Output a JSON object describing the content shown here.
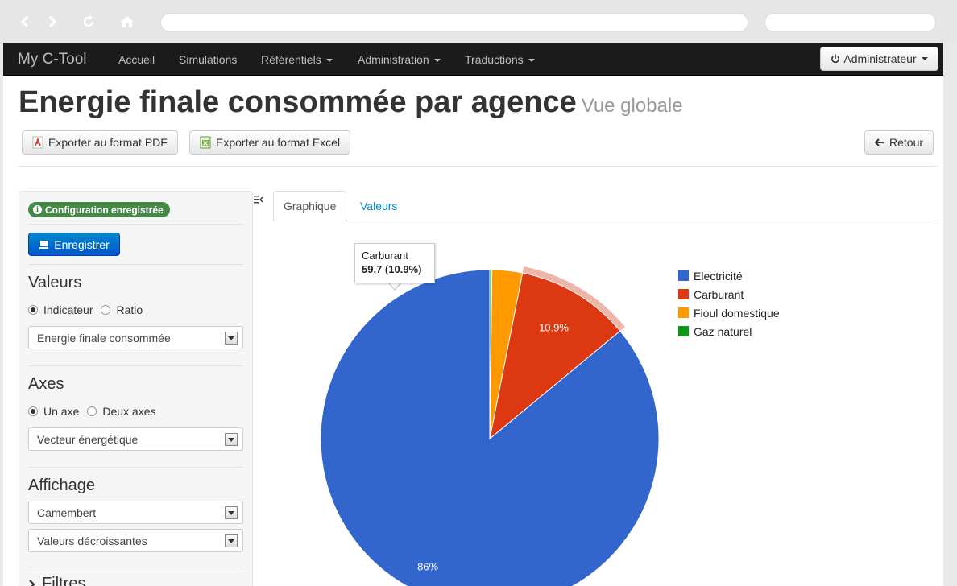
{
  "app": {
    "brand": "My C-Tool",
    "nav": [
      "Accueil",
      "Simulations",
      "Référentiels",
      "Administration",
      "Traductions"
    ],
    "user_button": "Administrateur"
  },
  "page": {
    "title": "Energie finale consommée par agence",
    "subtitle": "Vue globale",
    "export_pdf": "Exporter au format PDF",
    "export_excel": "Exporter au format Excel",
    "back": "Retour"
  },
  "sidebar": {
    "badge": "Configuration enregistrée",
    "save_button": "Enregistrer",
    "valeurs": {
      "title": "Valeurs",
      "radio_indicator": "Indicateur",
      "radio_ratio": "Ratio",
      "selected_radio": "Indicateur",
      "select": "Energie finale consommée"
    },
    "axes": {
      "title": "Axes",
      "radio_one": "Un axe",
      "radio_two": "Deux axes",
      "selected_radio": "Un axe",
      "select": "Vecteur énergétique"
    },
    "affichage": {
      "title": "Affichage",
      "select_type": "Camembert",
      "select_order": "Valeurs décroissantes"
    },
    "filtres": "Filtres"
  },
  "tabs": {
    "chart": "Graphique",
    "values": "Valeurs",
    "active": "Graphique"
  },
  "tooltip": {
    "label": "Carburant",
    "value": "59,7 (10.9%)"
  },
  "colors": {
    "electricite": "#3366cc",
    "carburant": "#dc3912",
    "fioul": "#ff9900",
    "gaz": "#109618",
    "badge": "#468847",
    "primary": "#0088cc"
  },
  "chart_data": {
    "type": "pie",
    "categories": [
      "Electricité",
      "Carburant",
      "Fioul domestique",
      "Gaz naturel"
    ],
    "values": [
      86,
      10.9,
      2.9,
      0.2
    ],
    "labels": [
      "86%",
      "10.9%",
      "",
      ""
    ],
    "highlighted": "Carburant",
    "legend_position": "right"
  }
}
